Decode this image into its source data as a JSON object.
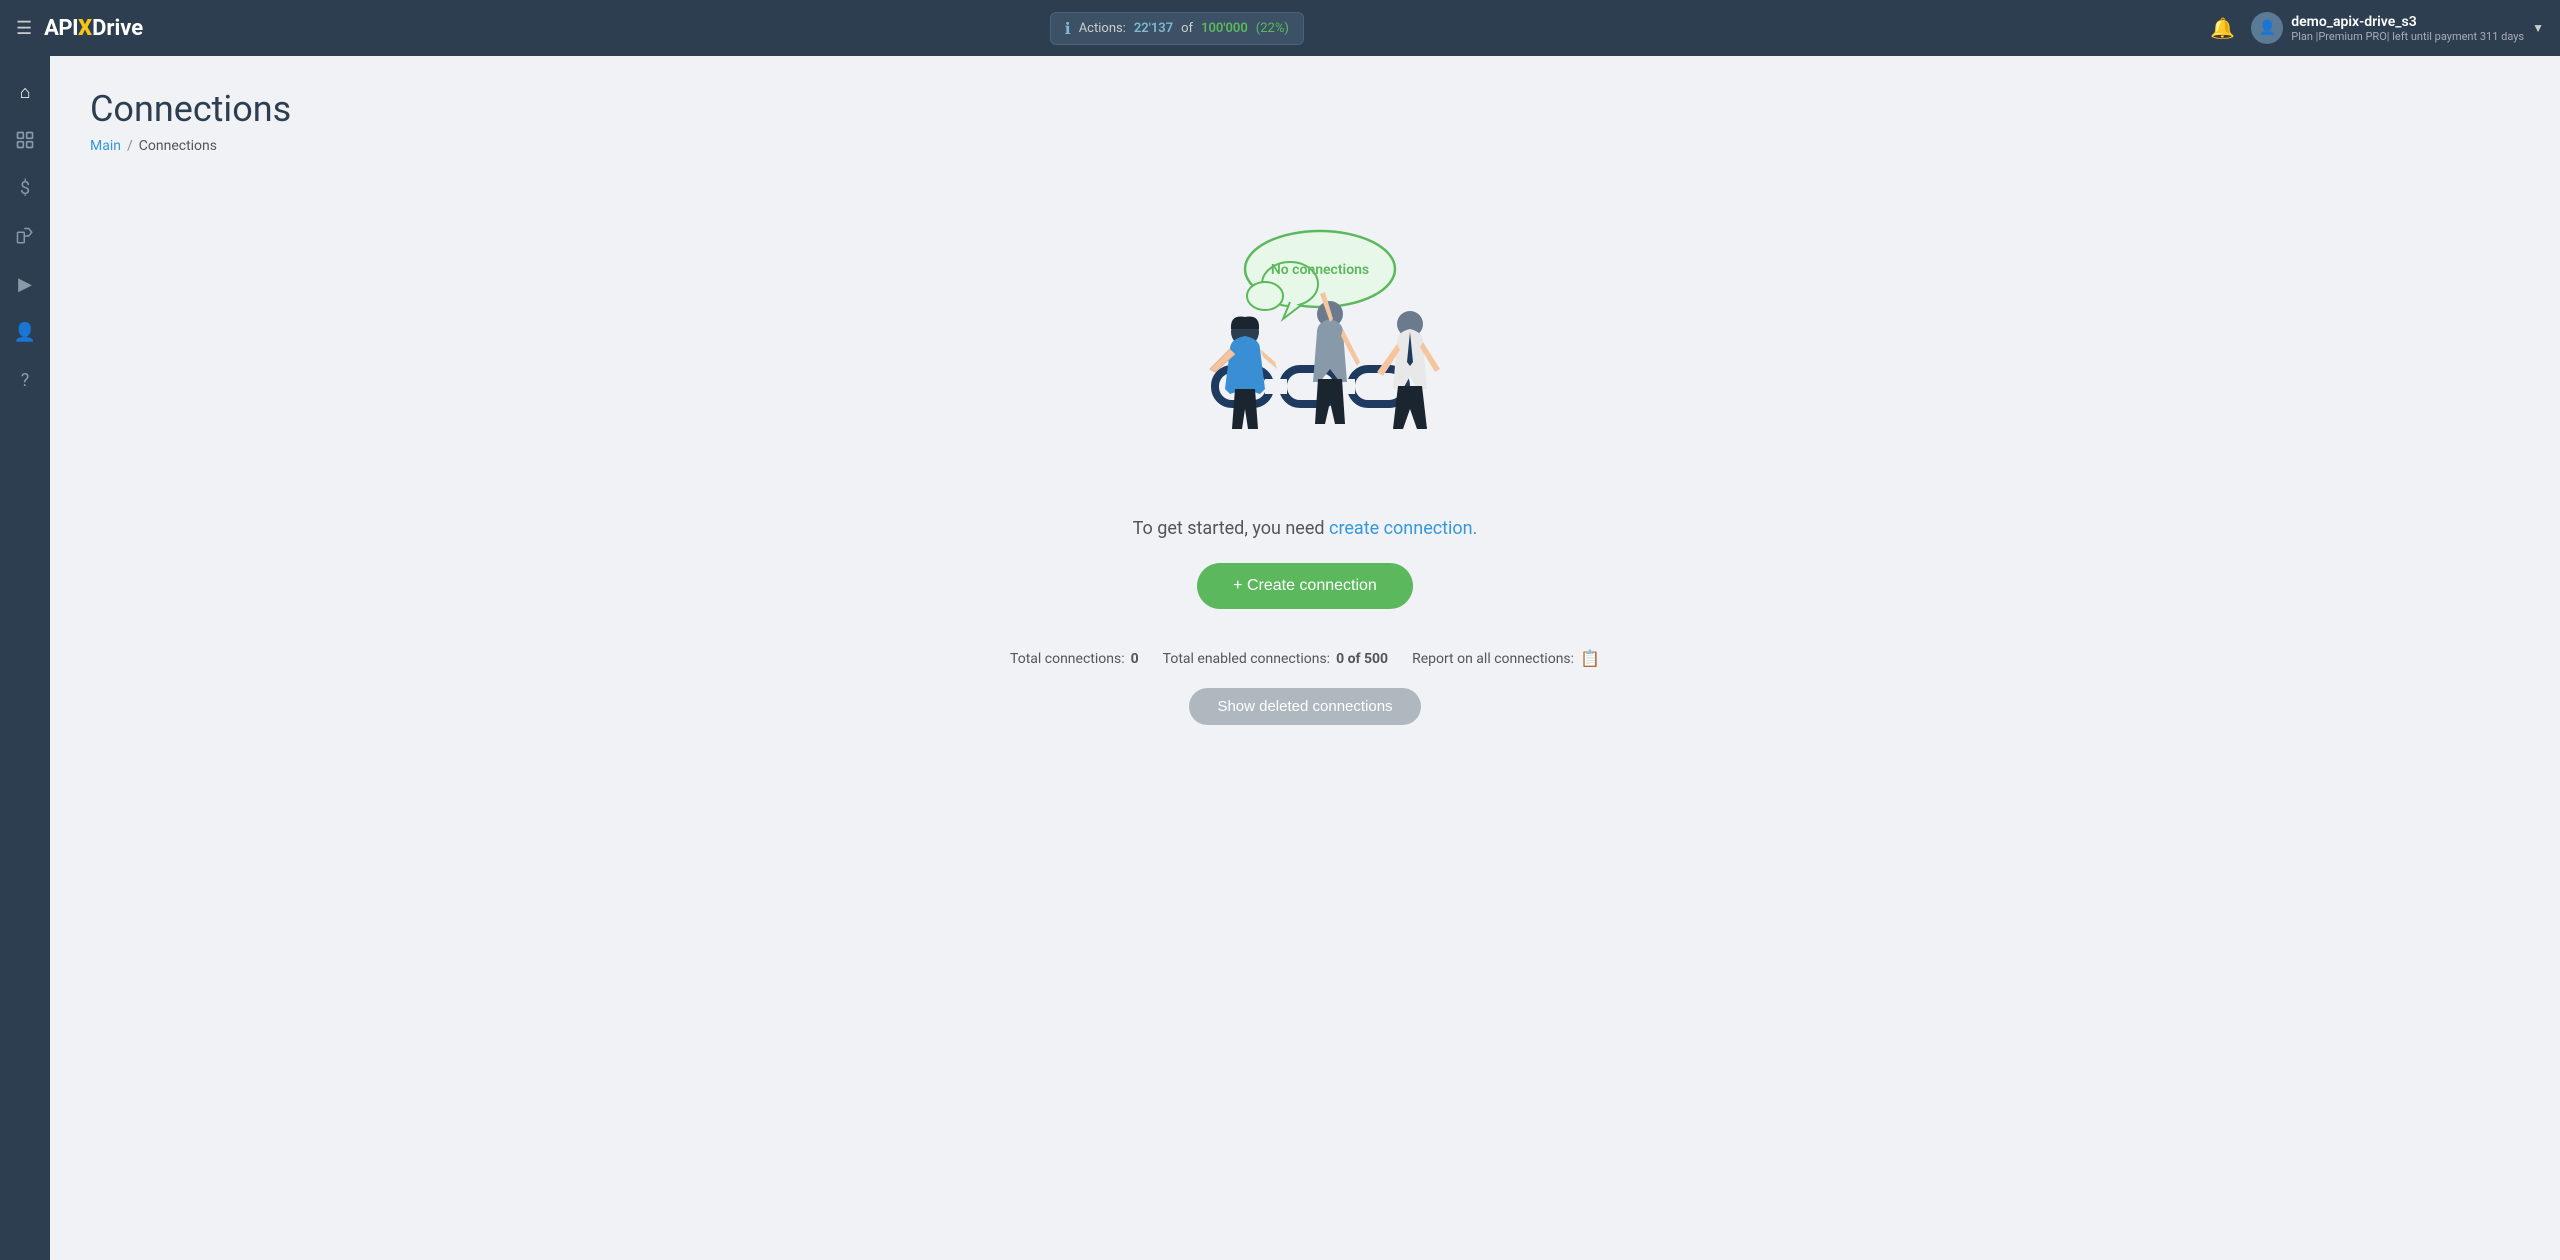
{
  "navbar": {
    "logo": {
      "api": "API",
      "x": "X",
      "drive": "Drive"
    },
    "actions": {
      "label": "Actions:",
      "count": "22'137",
      "of_text": "of",
      "total": "100'000",
      "percent": "(22%)"
    },
    "user": {
      "name": "demo_apix-drive_s3",
      "plan_label": "Plan |Premium PRO| left until payment",
      "days": "311 days"
    }
  },
  "sidebar": {
    "items": [
      {
        "icon": "⌂",
        "label": "home"
      },
      {
        "icon": "⣿",
        "label": "connections"
      },
      {
        "icon": "$",
        "label": "billing"
      },
      {
        "icon": "✎",
        "label": "integrations"
      },
      {
        "icon": "▶",
        "label": "automate"
      },
      {
        "icon": "👤",
        "label": "profile"
      },
      {
        "icon": "?",
        "label": "help"
      }
    ]
  },
  "page": {
    "title": "Connections",
    "breadcrumb_main": "Main",
    "breadcrumb_sep": "/",
    "breadcrumb_current": "Connections"
  },
  "empty_state": {
    "cloud_text": "No connections",
    "message_prefix": "To get started, you need ",
    "message_link": "create connection.",
    "create_button": "+ Create connection",
    "stats": {
      "total_label": "Total connections:",
      "total_value": "0",
      "enabled_label": "Total enabled connections:",
      "enabled_value": "0 of 500",
      "report_label": "Report on all connections:"
    },
    "show_deleted": "Show deleted connections"
  }
}
